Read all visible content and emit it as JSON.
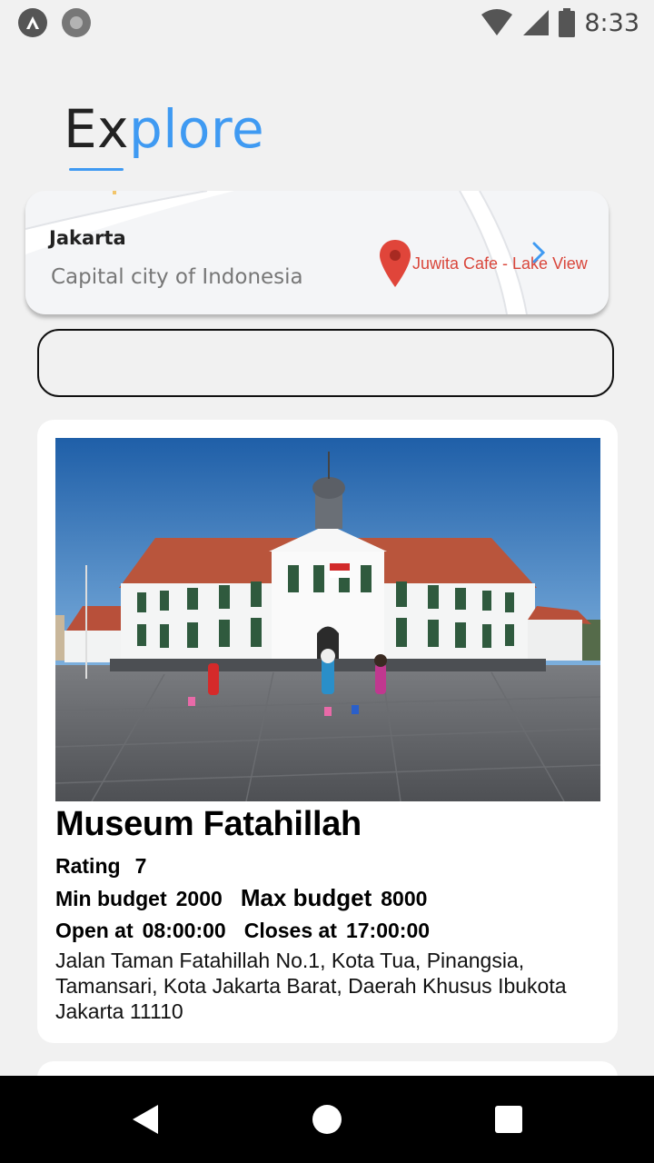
{
  "status_bar": {
    "time": "8:33",
    "left_icons": [
      "app-notification-icon",
      "circle-notification-icon"
    ],
    "right_icons": [
      "wifi-icon",
      "cellular-signal-icon",
      "battery-icon"
    ]
  },
  "header": {
    "title_prefix": "Ex",
    "title_suffix": "plore",
    "accent_color": "#3f9af2"
  },
  "map_card": {
    "city": "Jakarta",
    "description": "Capital city of Indonesia",
    "poi_label": "Juwita Cafe - Lake View",
    "poi_color": "#d9463b"
  },
  "search": {
    "value": "",
    "placeholder": ""
  },
  "places": [
    {
      "name": "Museum Fatahillah",
      "rating_label": "Rating",
      "rating": "7",
      "min_budget_label": "Min budget",
      "min_budget": "2000",
      "max_budget_label": "Max budget",
      "max_budget": "8000",
      "open_label": "Open at",
      "open_time": "08:00:00",
      "close_label": "Closes at",
      "close_time": "17:00:00",
      "address": "Jalan Taman Fatahillah No.1, Kota Tua, Pinangsia, Tamansari, Kota Jakarta Barat, Daerah Khusus Ibukota Jakarta 11110"
    }
  ],
  "nav_bar": {
    "icons": [
      "back-icon",
      "home-icon",
      "recents-icon"
    ]
  }
}
